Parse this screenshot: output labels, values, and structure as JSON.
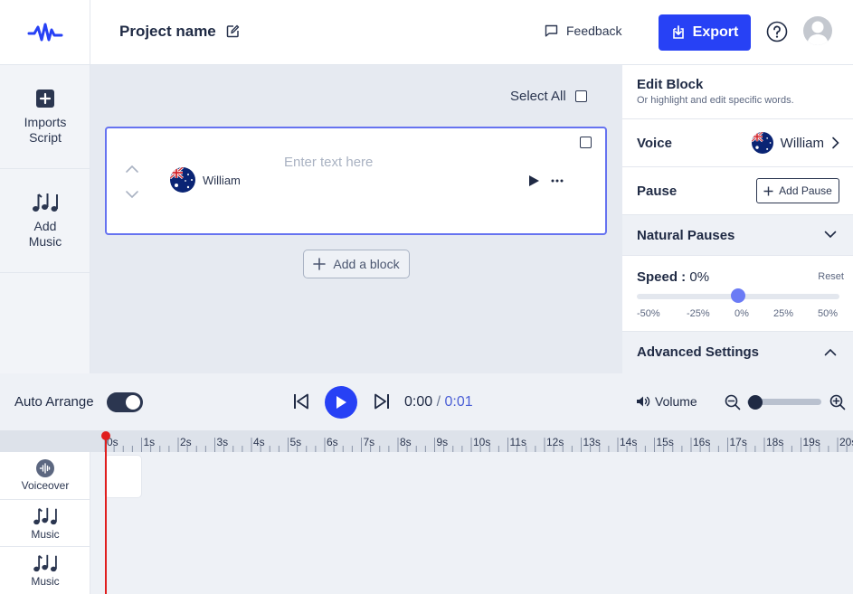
{
  "header": {
    "project_name": "Project name",
    "feedback_label": "Feedback",
    "export_label": "Export"
  },
  "rail": {
    "imports_line1": "Imports",
    "imports_line2": "Script",
    "music_line1": "Add",
    "music_line2": "Music"
  },
  "editor": {
    "select_all_label": "Select All",
    "block": {
      "voice_name": "William",
      "placeholder": "Enter text here"
    },
    "add_block_label": "Add a block"
  },
  "panel": {
    "title": "Edit Block",
    "subtitle": "Or highlight and edit specific words.",
    "voice_label": "Voice",
    "voice_value": "William",
    "pause_label": "Pause",
    "add_pause_label": "Add Pause",
    "natural_pauses_label": "Natural Pauses",
    "speed_label": "Speed :",
    "speed_value": "0%",
    "speed_reset": "Reset",
    "speed_fraction": 0.5,
    "speed_ticks": [
      "-50%",
      "-25%",
      "0%",
      "25%",
      "50%"
    ],
    "advanced_label": "Advanced Settings"
  },
  "transport": {
    "auto_arrange_label": "Auto Arrange",
    "auto_arrange_on": true,
    "time_current": "0:00",
    "time_separator": " / ",
    "time_total": "0:01",
    "volume_label": "Volume",
    "zoom_fraction": 0.0
  },
  "timeline": {
    "ruler_labels": [
      "0s",
      "1s",
      "2s",
      "3s",
      "4s",
      "5s",
      "6s",
      "7s",
      "8s",
      "9s",
      "10s",
      "11s",
      "12s",
      "13s",
      "14s",
      "15s",
      "16s",
      "17s",
      "18s",
      "19s",
      "20s"
    ],
    "tracks": [
      {
        "label": "Voiceover",
        "icon": "waveform-icon"
      },
      {
        "label": "Music",
        "icon": "music-notes-icon"
      },
      {
        "label": "Music",
        "icon": "music-notes-icon"
      }
    ]
  },
  "colors": {
    "accent": "#2741f5",
    "playhead": "#e01e1e",
    "block_border": "#6673f0",
    "slider_thumb": "#6b7bf5"
  }
}
